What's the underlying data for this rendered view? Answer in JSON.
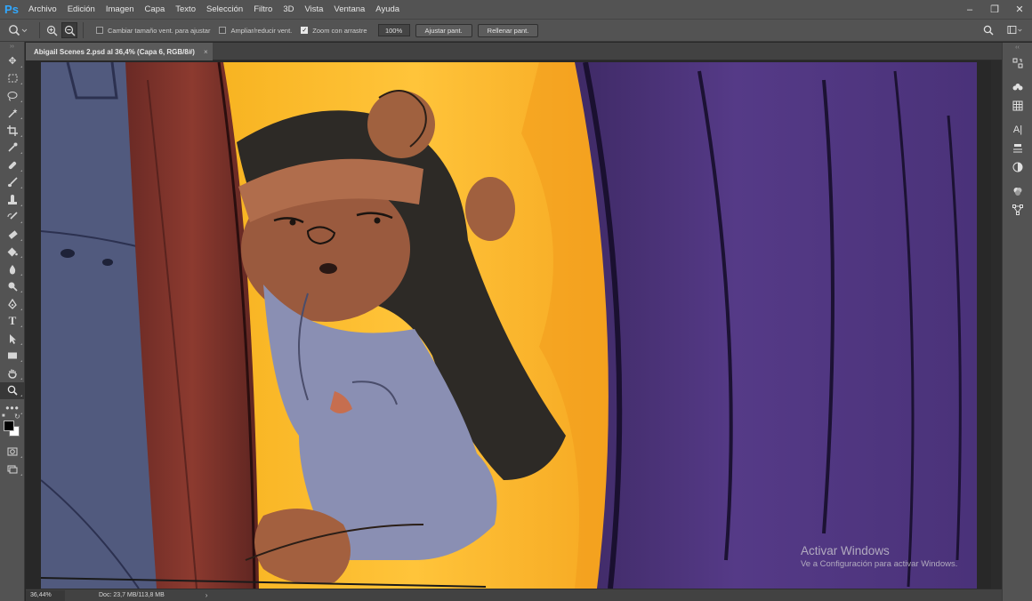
{
  "app": {
    "logo": "Ps",
    "menu": [
      "Archivo",
      "Edición",
      "Imagen",
      "Capa",
      "Texto",
      "Selección",
      "Filtro",
      "3D",
      "Vista",
      "Ventana",
      "Ayuda"
    ],
    "window_controls": [
      "minimize-icon",
      "restore-icon",
      "close-icon"
    ]
  },
  "options": {
    "tool_icon": "zoom-icon",
    "zoom_in_icon": "zoom-in-icon",
    "zoom_out_icon": "zoom-out-icon",
    "resize_windows_label": "Cambiar tamaño vent. para ajustar",
    "resize_windows_checked": false,
    "zoom_all_label": "Ampliar/reducir vent.",
    "zoom_all_checked": false,
    "scrubby_zoom_label": "Zoom con arrastre",
    "scrubby_zoom_checked": true,
    "zoom_percent": "100%",
    "fit_screen": "Ajustar pant.",
    "fill_screen": "Rellenar pant."
  },
  "document": {
    "tab_title": "Abigail Scenes 2.psd al 36,4% (Capa 6, RGB/8#)",
    "tab_close": "×"
  },
  "status": {
    "zoom": "36,44%",
    "doc_size": "Doc: 23,7 MB/113,8 MB",
    "arrow": "›"
  },
  "watermark": {
    "title": "Activar Windows",
    "subtitle": "Ve a Configuración para activar Windows."
  },
  "colors": {
    "foreground": "#000000",
    "background": "#ffffff",
    "accent_ps": "#31a8ff"
  }
}
